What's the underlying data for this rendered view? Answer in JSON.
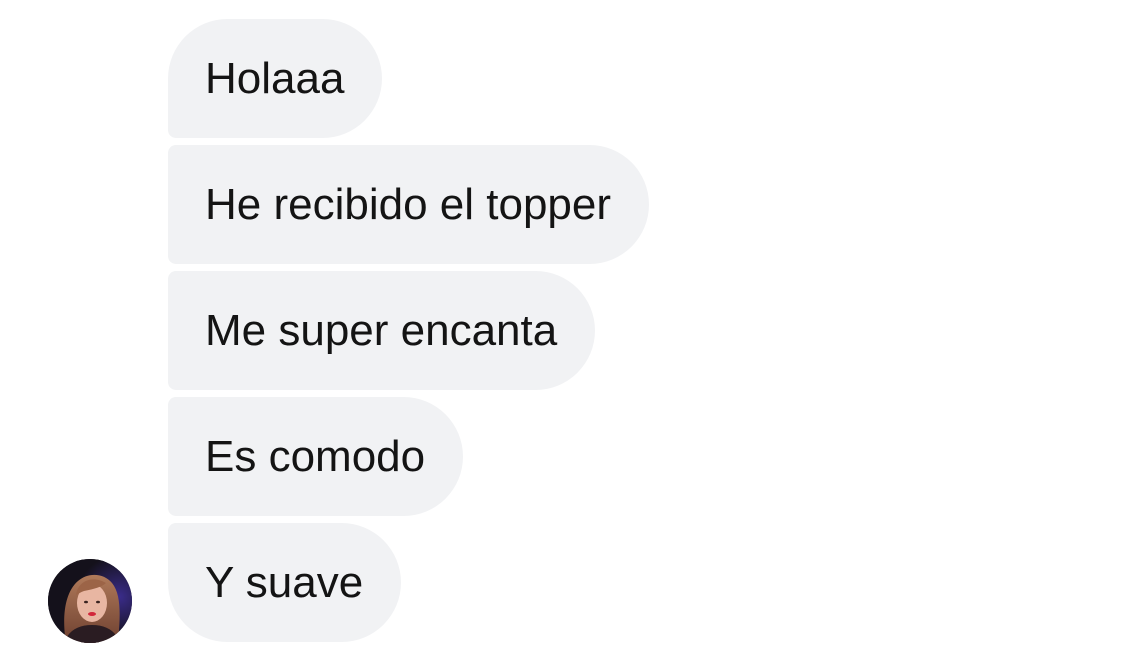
{
  "conversation": {
    "messages": [
      {
        "text": "Holaaa"
      },
      {
        "text": "He recibido el topper"
      },
      {
        "text": "Me super encanta"
      },
      {
        "text": "Es comodo"
      },
      {
        "text": "Y suave"
      }
    ],
    "sender": {
      "avatar_icon": "user-avatar-photo"
    }
  },
  "colors": {
    "bubble_background": "#f1f2f4",
    "text": "#141414",
    "page_background": "#ffffff"
  }
}
